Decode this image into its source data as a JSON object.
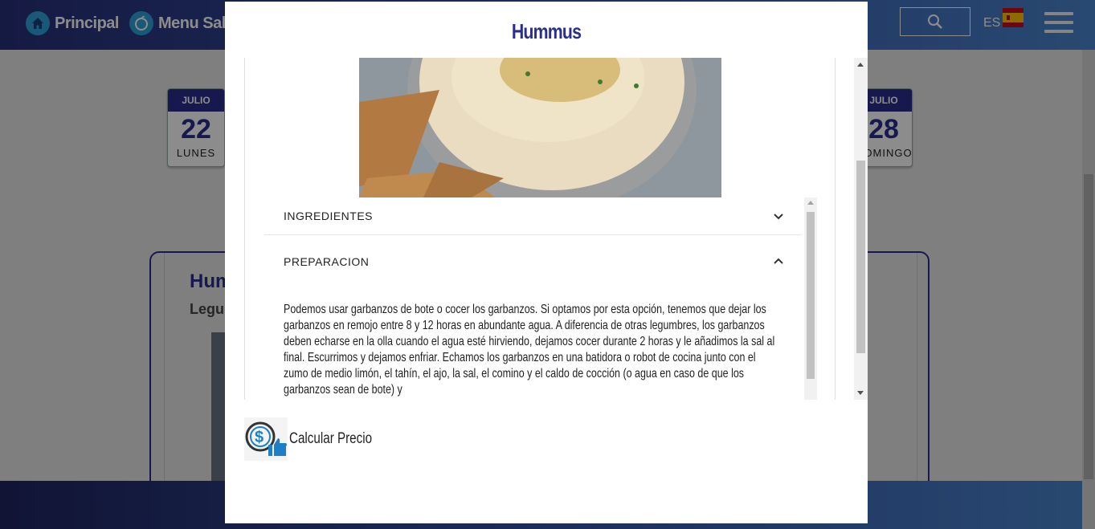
{
  "nav": {
    "home_label": "Principal",
    "menu_label": "Menu Saludable",
    "language": "ES"
  },
  "calendar": [
    {
      "month": "JULIO",
      "day": "22",
      "weekday": "LUNES"
    },
    {
      "month": "JULIO",
      "day": "28",
      "weekday": "DOMINGO"
    }
  ],
  "background_recipe": {
    "title": "Hummus",
    "category": "Legumbres"
  },
  "modal": {
    "title": "Hummus",
    "sections": [
      {
        "label": "INGREDIENTES",
        "expanded": false
      },
      {
        "label": "PREPARACION",
        "expanded": true
      }
    ],
    "preparation_text": "Podemos usar garbanzos de bote o cocer los garbanzos. Si optamos por esta opción, tenemos que dejar los garbanzos en remojo entre 8 y 12 horas en abundante agua. A diferencia de otras legumbres, los garbanzos deben echarse en la olla cuando el agua esté hirviendo, dejamos cocer durante 2 horas y le añadimos la sal al final. Escurrimos y dejamos enfriar. Echamos los garbanzos en una batidora o robot de cocina junto con el zumo de medio limón, el tahín, el ajo, la sal, el comino y el caldo de cocción (o agua en caso de que los garbanzos sean de bote) y",
    "calc_price_label": "Calcular Precio"
  },
  "colors": {
    "brand": "#2a2f8e",
    "accent": "#2ea2db"
  },
  "icons": [
    "home-icon",
    "apple-icon",
    "search-icon",
    "spain-flag-icon",
    "hamburger-menu-icon",
    "chevron-down-icon",
    "chevron-up-icon",
    "price-money-icon"
  ]
}
